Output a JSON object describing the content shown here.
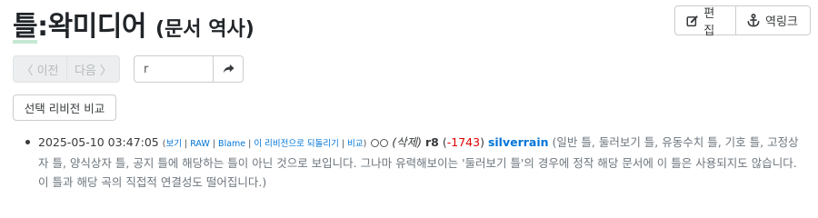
{
  "page": {
    "title_namespace": "틀",
    "title_rest": ":왁미디어",
    "subtitle": "(문서 역사)"
  },
  "toolbar": {
    "edit_label": "편집",
    "backlinks_label": "역링크"
  },
  "nav": {
    "prev_label": "〈 이전",
    "next_label": "다음 〉",
    "jump_value": "r"
  },
  "compare_label": "선택 리비전 비교",
  "history": [
    {
      "date": "2025-05-10 03:47:05",
      "paren_open": "(",
      "links": [
        "보기",
        "RAW",
        "Blame",
        "이 리비전으로 되돌리기",
        "비교"
      ],
      "sep": " | ",
      "paren_close": ")",
      "action": "(삭제)",
      "rev": "r8",
      "delta_open": "(",
      "delta": "-1743",
      "delta_close": ")",
      "user": "silverrain",
      "comment": "(일반 틀, 둘러보기 틀, 유동수치 틀, 기호 틀, 고정상자 틀, 양식상자 틀, 공지 틀에 해당하는 틀이 아닌 것으로 보입니다. 그나마 유력해보이는 '둘러보기 틀'의 경우에 정작 해당 문서에 이 틀은 사용되지도 않습니다. 이 틀과 해당 곡의 직접적 연결성도 떨어집니다.)"
    }
  ],
  "colors": {
    "link": "#0275d8",
    "delta_negative": "#e00000",
    "namespace_underline": "#c6e8d2"
  },
  "icons": {
    "edit": "edit-square-icon",
    "backlinks": "anchor-icon",
    "jump": "share-arrow-icon"
  }
}
